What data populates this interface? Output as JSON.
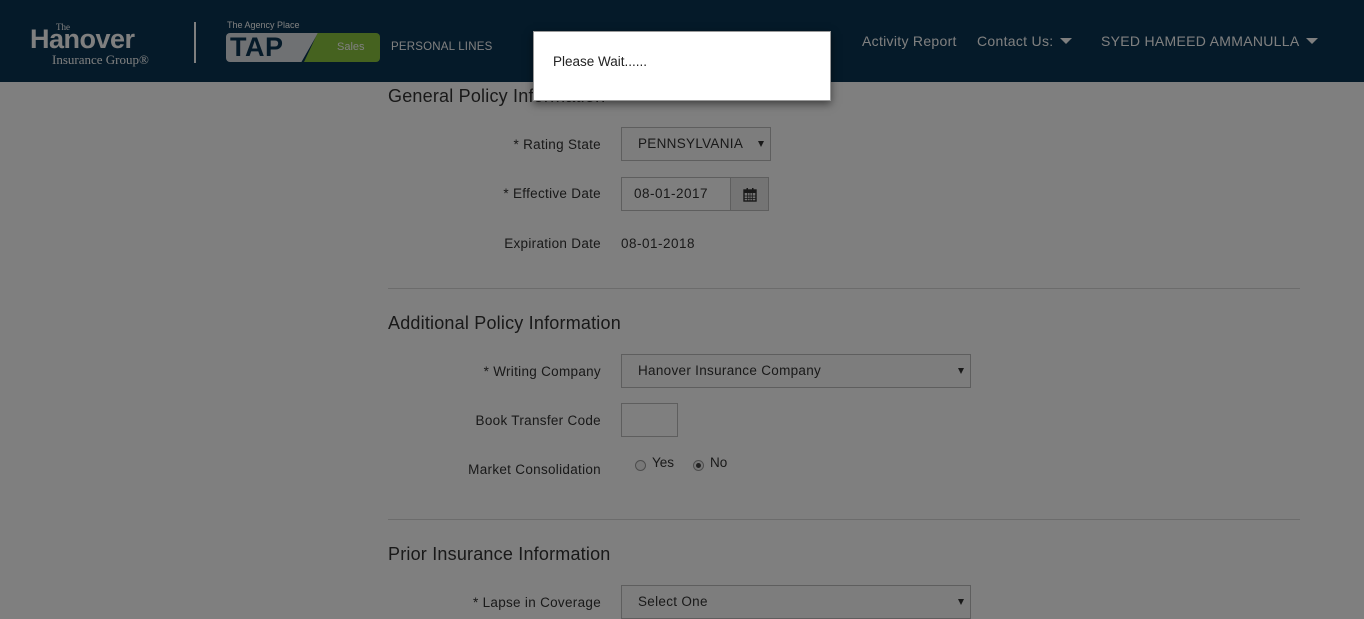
{
  "header": {
    "logo": {
      "the": "The",
      "name": "Hanover",
      "sub": "Insurance Group®"
    },
    "tap": {
      "caption": "The Agency Place",
      "tap": "TAP",
      "sales": "Sales"
    },
    "personal_lines": "PERSONAL LINES",
    "nav": {
      "activity_report": "Activity Report",
      "contact_us": "Contact Us:",
      "user": "SYED HAMEED AMMANULLA"
    }
  },
  "general": {
    "title": "General Policy Information",
    "rating_state_label": "* Rating State",
    "rating_state_value": "PENNSYLVANIA",
    "effective_date_label": "* Effective Date",
    "effective_date_value": "08-01-2017",
    "expiration_date_label": "Expiration Date",
    "expiration_date_value": "08-01-2018"
  },
  "additional": {
    "title": "Additional Policy Information",
    "writing_company_label": "* Writing Company",
    "writing_company_value": "Hanover Insurance Company",
    "book_transfer_label": "Book Transfer Code",
    "book_transfer_value": "",
    "market_consolidation_label": "Market Consolidation",
    "yes_label": "Yes",
    "no_label": "No",
    "market_consolidation_selected": "No"
  },
  "prior": {
    "title": "Prior Insurance Information",
    "lapse_label": "* Lapse in Coverage",
    "lapse_value": "Select One"
  },
  "modal": {
    "message": "Please Wait......"
  },
  "colors": {
    "header_bg": "#0b3552",
    "sales_green": "#8ac43f"
  }
}
